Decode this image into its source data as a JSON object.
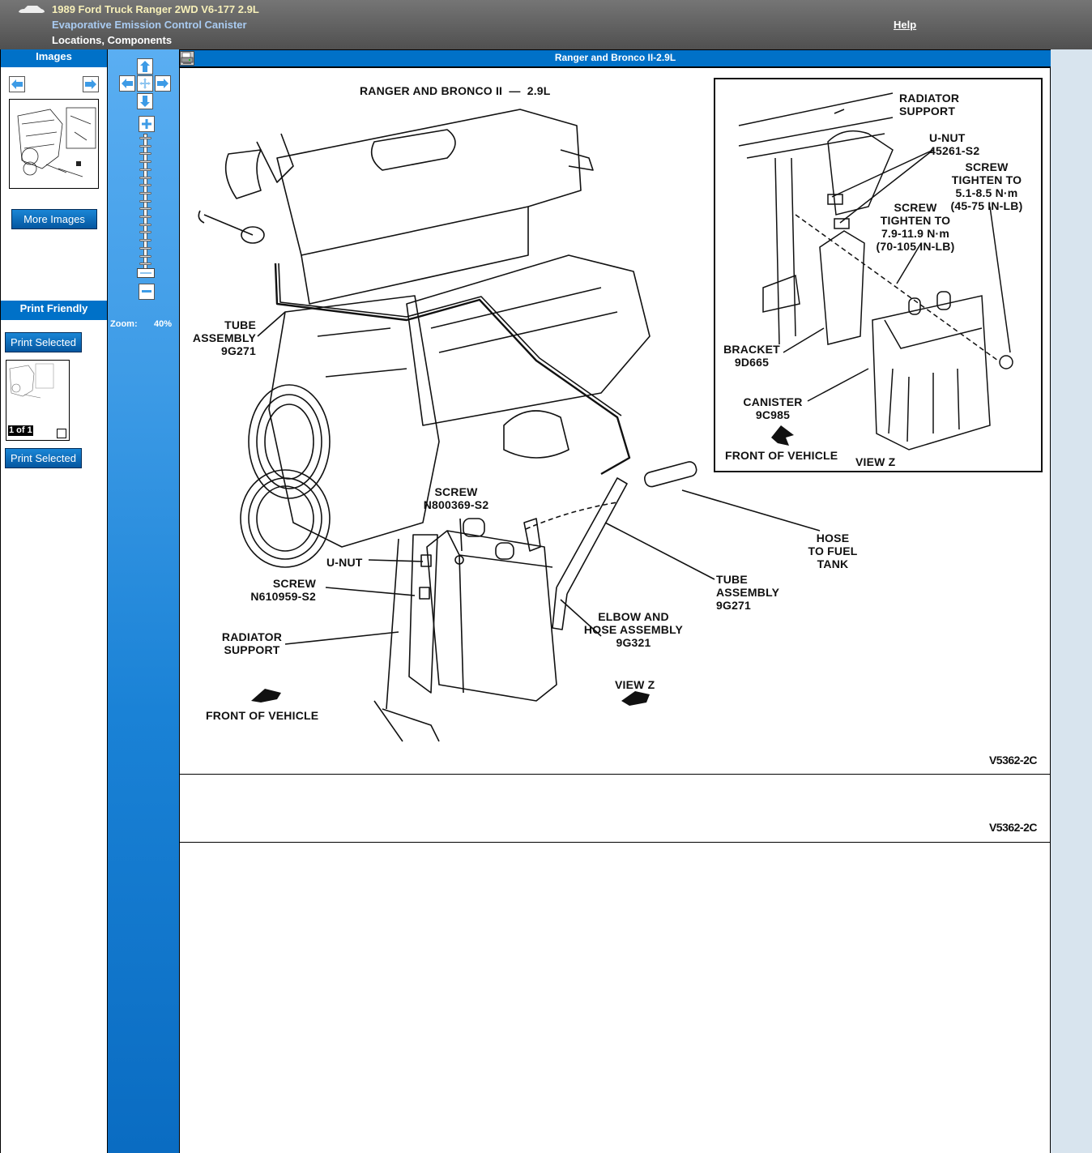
{
  "header": {
    "vehicle": "1989 Ford Truck Ranger 2WD V6-177 2.9L",
    "component": "Evaporative Emission Control Canister",
    "section": "Locations, Components",
    "help_link": "Help",
    "car_icon": "car-icon"
  },
  "left_panel": {
    "images_heading": "Images",
    "prev_icon": "arrow-left-icon",
    "next_icon": "arrow-right-icon",
    "more_images_button": "More Images",
    "print_friendly_heading": "Print Friendly",
    "print_selected_top": "Print Selected",
    "print_selected_bottom": "Print Selected",
    "page_count": "1 of 1",
    "select_checked": false
  },
  "zoom_panel": {
    "pan_icons": [
      "arrow-up-icon",
      "arrow-left-icon",
      "center-icon",
      "arrow-right-icon",
      "arrow-down-icon"
    ],
    "zoom_in_icon": "plus-icon",
    "zoom_out_icon": "minus-icon",
    "zoom_label": "Zoom:",
    "zoom_value": "40%",
    "zoom_percent": 40
  },
  "viewer": {
    "title": "Ranger and Bronco II-2.9L",
    "print_icon": "printer-icon",
    "diagram": {
      "heading": "RANGER AND BRONCO II  —  2.9L",
      "labels": {
        "tube_assembly_left": "TUBE\nASSEMBLY\n9G271",
        "screw_n800369": "SCREW\nN800369-S2",
        "u_nut": "U-NUT",
        "screw_n610959": "SCREW\nN610959-S2",
        "radiator_support_main": "RADIATOR\nSUPPORT",
        "front_of_vehicle_main": "FRONT OF VEHICLE",
        "view_z_main": "VIEW Z",
        "elbow_hose": "ELBOW AND\nHOSE ASSEMBLY\n9G321",
        "tube_assembly_right": "TUBE\nASSEMBLY\n9G271",
        "hose_fuel_tank": "HOSE\nTO FUEL\nTANK"
      },
      "inset_labels": {
        "radiator_support": "RADIATOR\nSUPPORT",
        "u_nut": "U-NUT\n45261-S2",
        "screw_upper": "SCREW\nTIGHTEN TO\n5.1-8.5 N·m\n(45-75 IN-LB)",
        "screw_lower": "SCREW\nTIGHTEN TO\n7.9-11.9 N·m\n(70-105 IN-LB)",
        "bracket": "BRACKET\n9D665",
        "canister": "CANISTER\n9C985",
        "front_of_vehicle": "FRONT OF VEHICLE",
        "view_z": "VIEW Z"
      },
      "code": "V5362-2C"
    },
    "diagram2_code": "V5362-2C"
  }
}
